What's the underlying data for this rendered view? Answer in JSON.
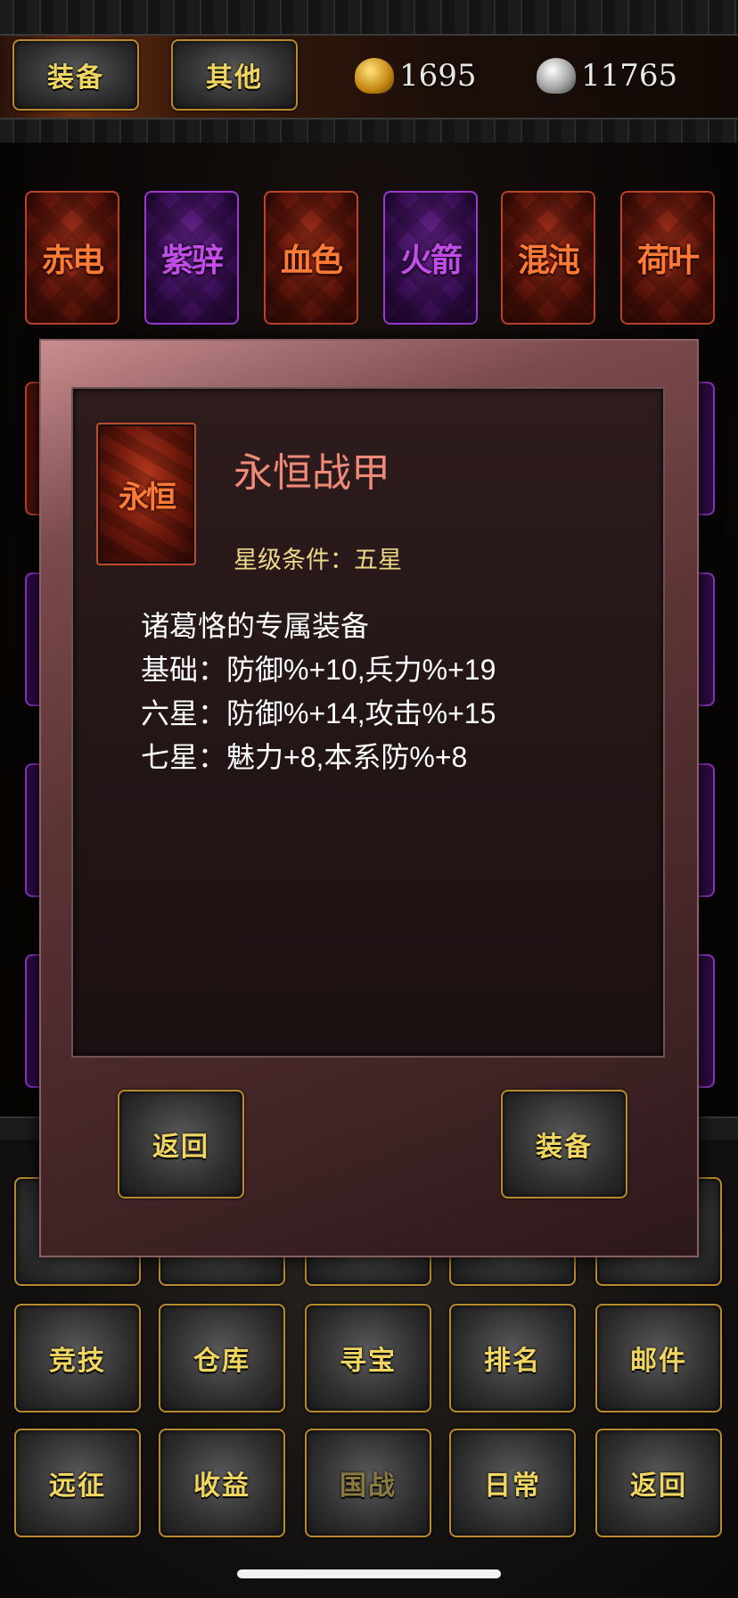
{
  "top_bar": {
    "tab_equip": "装备",
    "tab_other": "其他",
    "gold": "1695",
    "silver": "11765",
    "gold_icon": "gold-ingot-icon",
    "silver_icon": "silver-ingot-icon"
  },
  "cards": [
    {
      "label": "赤电",
      "color": "red"
    },
    {
      "label": "紫骍",
      "color": "purple"
    },
    {
      "label": "血色",
      "color": "red"
    },
    {
      "label": "火箭",
      "color": "purple"
    },
    {
      "label": "混沌",
      "color": "red"
    },
    {
      "label": "荷叶",
      "color": "red"
    }
  ],
  "dialog": {
    "icon_label": "永恒",
    "name": "永恒战甲",
    "condition": "星级条件：五星",
    "lines": [
      "诸葛恪的专属装备",
      "基础：防御%+10,兵力%+19",
      "六星：防御%+14,攻击%+15",
      "七星：魅力+8,本系防%+8"
    ],
    "back_button": "返回",
    "equip_button": "装备"
  },
  "menu": {
    "row1": [
      "竞技",
      "仓库",
      "寻宝",
      "排名",
      "邮件"
    ],
    "row2": [
      "远征",
      "收益",
      "国战",
      "日常",
      "返回"
    ]
  },
  "colors": {
    "accent_gold": "#f0d660",
    "red_card": "#b8442a",
    "purple_card": "#9a3ad0",
    "item_name": "#f08a78",
    "condition": "#f0d88a"
  }
}
